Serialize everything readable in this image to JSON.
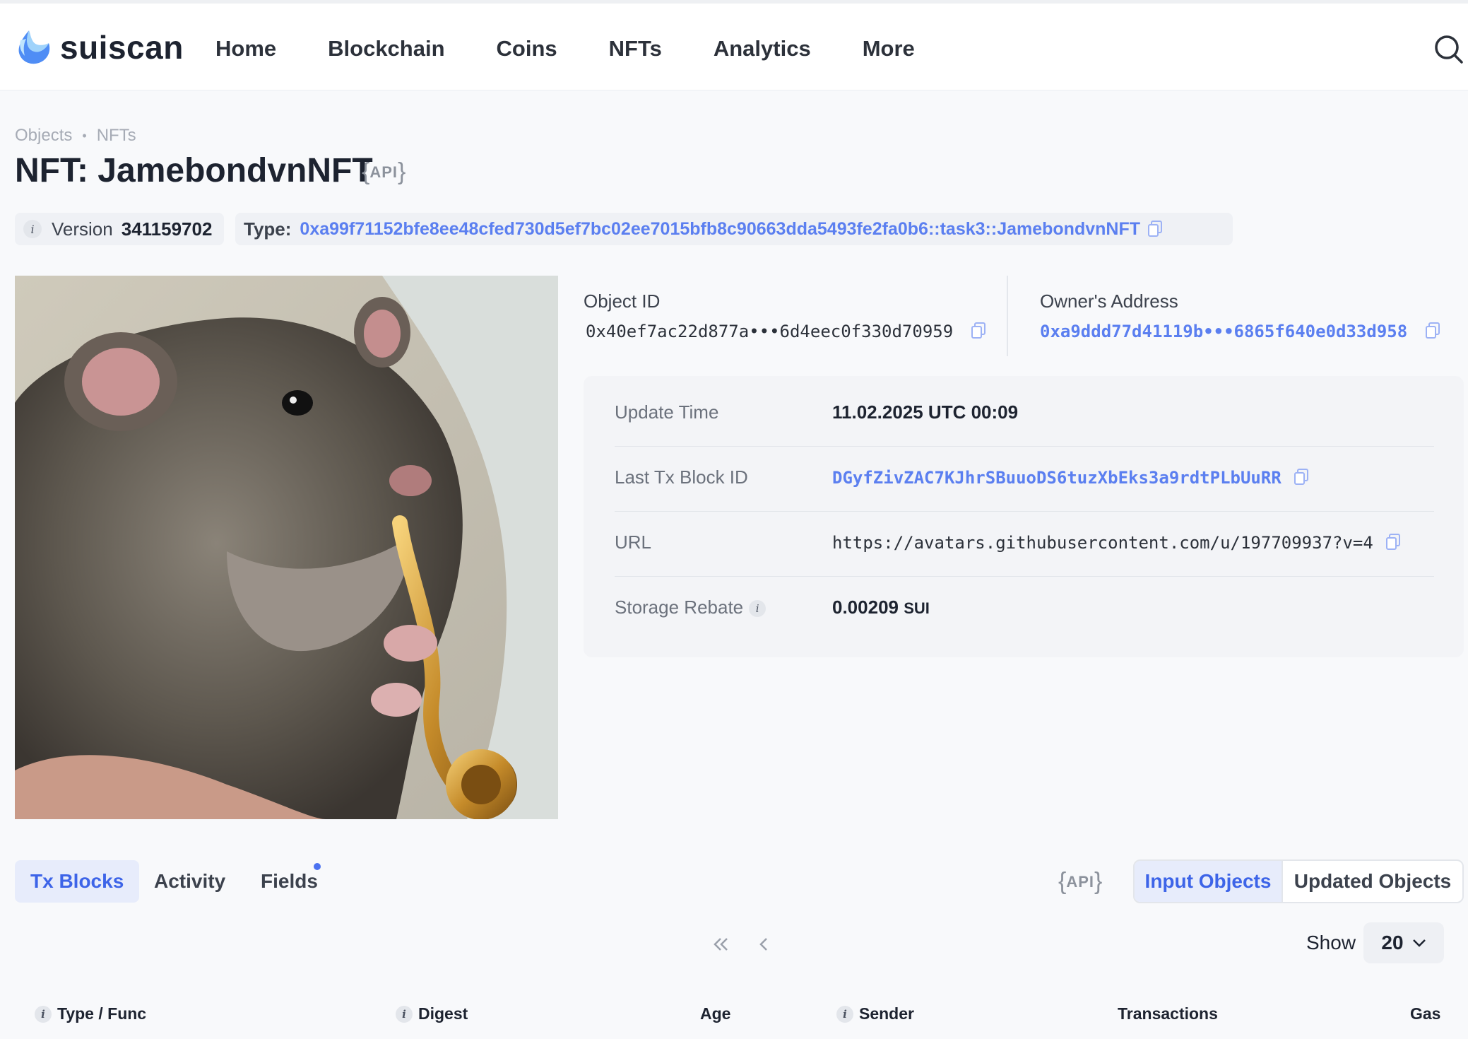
{
  "app": {
    "name": "suiscan"
  },
  "nav": [
    "Home",
    "Blockchain",
    "Coins",
    "NFTs",
    "Analytics",
    "More"
  ],
  "breadcrumb": {
    "items": [
      "Objects",
      "NFTs"
    ]
  },
  "page": {
    "title": "NFT: JamebondvnNFT",
    "api_label": "API"
  },
  "version": {
    "label": "Version",
    "value": "341159702"
  },
  "type": {
    "label": "Type:",
    "value": "0xa99f71152bfe8ee48cfed730d5ef7bc02ee7015bfb8c90663dda5493fe2fa0b6::task3::JamebondvnNFT"
  },
  "object": {
    "id_label": "Object ID",
    "id_value": "0x40ef7ac22d877a•••6d4eec0f330d70959",
    "owner_label": "Owner's Address",
    "owner_value": "0xa9ddd77d41119b•••6865f640e0d33d958"
  },
  "details": [
    {
      "label": "Update Time",
      "value": "11.02.2025 UTC 00:09"
    },
    {
      "label": "Last Tx Block ID",
      "value": "DGyfZivZAC7KJhrSBuuoDS6tuzXbEks3a9rdtPLbUuRR"
    },
    {
      "label": "URL",
      "value": "https://avatars.githubusercontent.com/u/197709937?v=4"
    },
    {
      "label": "Storage Rebate",
      "value": "0.00209",
      "unit": "SUI"
    }
  ],
  "tabs": [
    "Tx Blocks",
    "Activity",
    "Fields"
  ],
  "segment": {
    "active": "Input Objects",
    "other": "Updated Objects"
  },
  "pager": {
    "show_label": "Show",
    "page_size": "20"
  },
  "table": {
    "columns": [
      "Type / Func",
      "Digest",
      "Age",
      "Sender",
      "Transactions",
      "Gas"
    ]
  },
  "colors": {
    "accent": "#5b7ff0",
    "active_tab_bg": "#e7ecfb",
    "text": "#1d2330"
  }
}
